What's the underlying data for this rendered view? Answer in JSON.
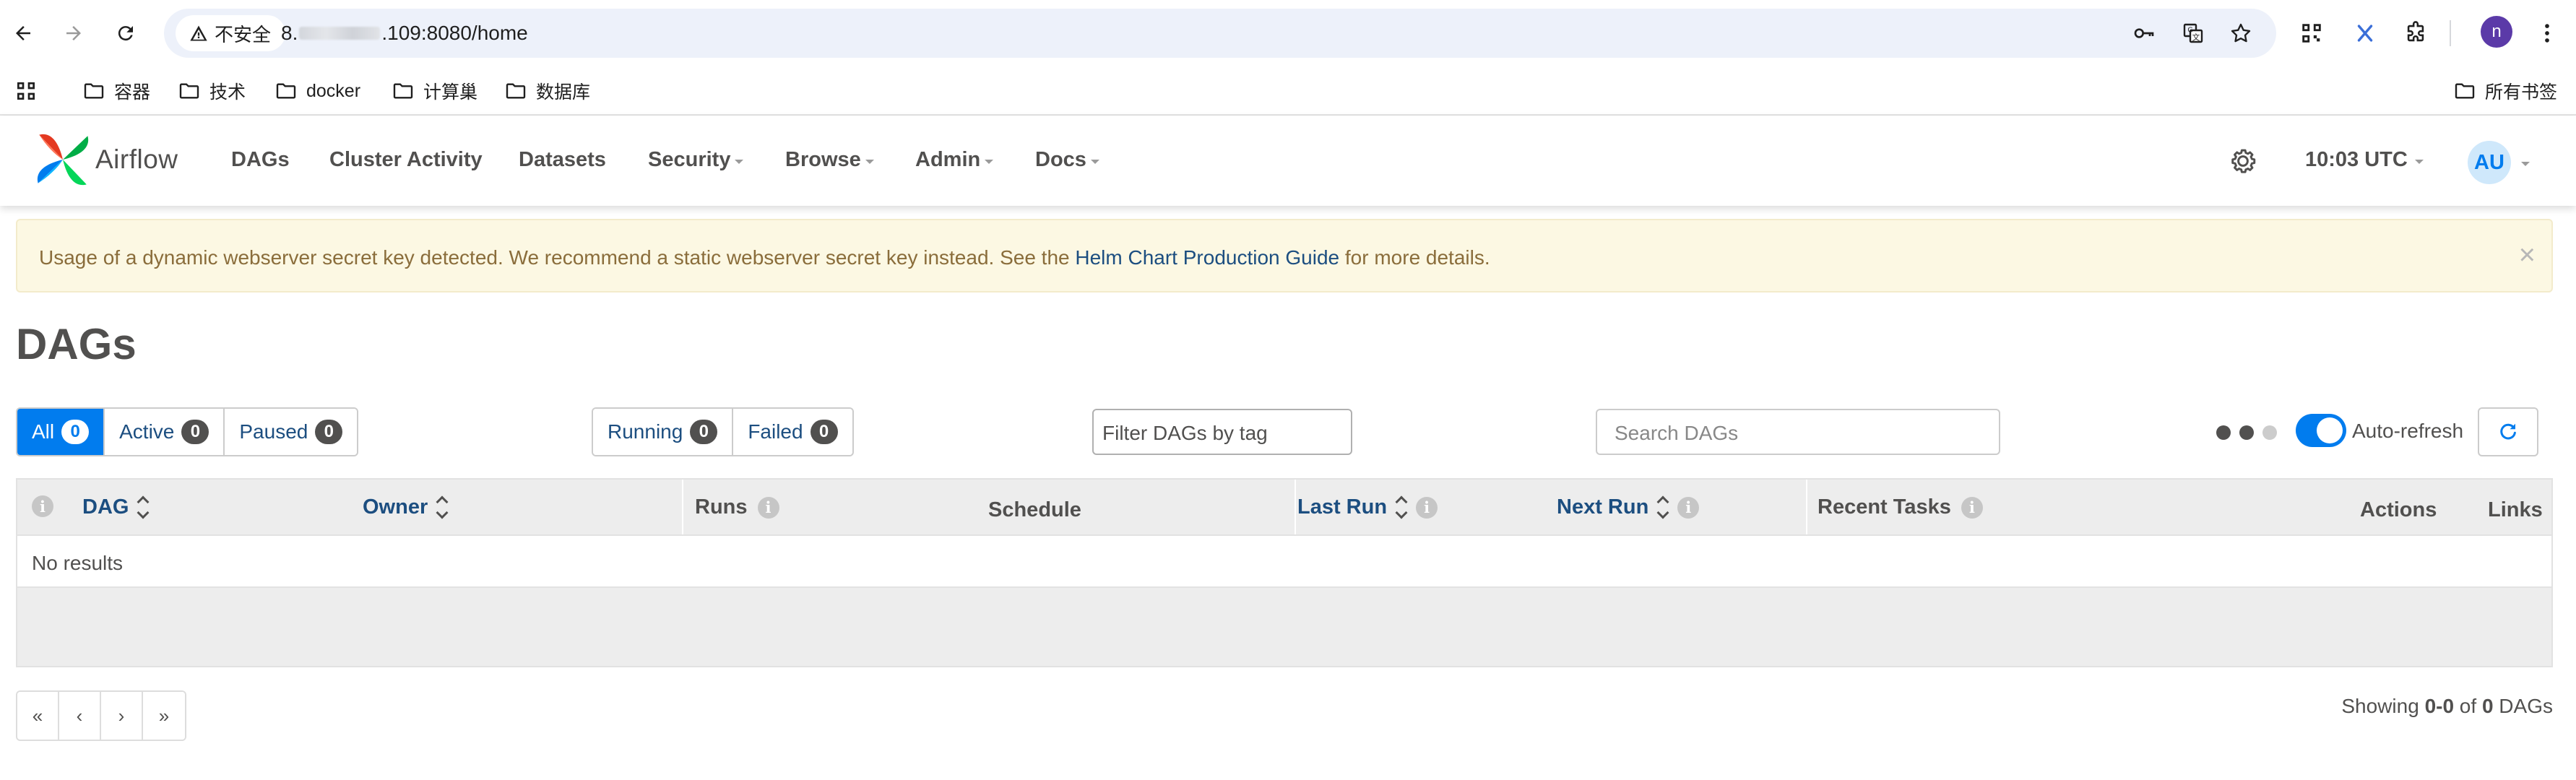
{
  "browser": {
    "security_label": "不安全",
    "url_prefix": "8.",
    "url_suffix": ".109:8080/home",
    "profile_initial": "n",
    "bookmarks": [
      "容器",
      "技术",
      "docker",
      "计算巢",
      "数据库"
    ],
    "all_bookmarks": "所有书签"
  },
  "nav": {
    "brand": "Airflow",
    "items": [
      "DAGs",
      "Cluster Activity",
      "Datasets",
      "Security",
      "Browse",
      "Admin",
      "Docs"
    ],
    "time": "10:03 UTC",
    "avatar": "AU"
  },
  "alert": {
    "text_before": "Usage of a dynamic webserver secret key detected. We recommend a static webserver secret key instead. See the ",
    "link": "Helm Chart Production Guide",
    "text_after": " for more details.",
    "close": "×"
  },
  "page": {
    "title": "DAGs"
  },
  "filters": {
    "status": [
      {
        "label": "All",
        "count": "0"
      },
      {
        "label": "Active",
        "count": "0"
      },
      {
        "label": "Paused",
        "count": "0"
      }
    ],
    "runs": [
      {
        "label": "Running",
        "count": "0"
      },
      {
        "label": "Failed",
        "count": "0"
      }
    ],
    "tag_placeholder": "Filter DAGs by tag",
    "search_placeholder": "Search DAGs",
    "auto_refresh": "Auto-refresh",
    "auto_refresh_on": true
  },
  "table": {
    "headers": [
      "DAG",
      "Owner",
      "Runs",
      "Schedule",
      "Last Run",
      "Next Run",
      "Recent Tasks",
      "Actions",
      "Links"
    ],
    "empty": "No results"
  },
  "pagination": {
    "buttons": [
      "«",
      "‹",
      "›",
      "»"
    ],
    "showing_prefix": "Showing ",
    "range": "0-0",
    "of": " of ",
    "total": "0",
    "suffix": " DAGs"
  },
  "colors": {
    "accent": "#017cee",
    "link": "#1c4e80",
    "text": "#51504f",
    "alert_bg": "#fcf8e3"
  }
}
